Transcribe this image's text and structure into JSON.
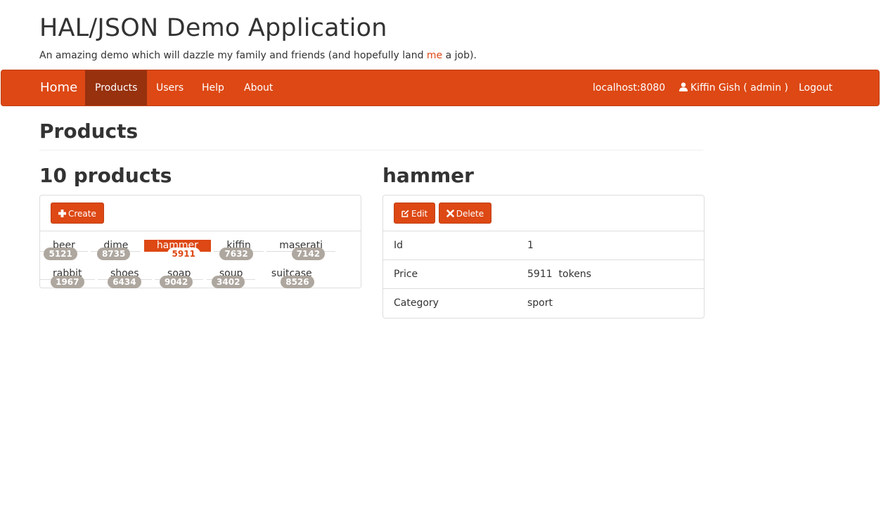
{
  "header": {
    "title": "HAL/JSON Demo Application",
    "tagline_before": "An amazing demo which will dazzle my family and friends (and hopefully land ",
    "tagline_link": "me",
    "tagline_after": " a job)."
  },
  "navbar": {
    "brand": "Home",
    "items": [
      {
        "label": "Products",
        "active": true
      },
      {
        "label": "Users"
      },
      {
        "label": "Help"
      },
      {
        "label": "About"
      }
    ],
    "host": "localhost:8080",
    "user": "Kiffin Gish ( admin )",
    "logout": "Logout"
  },
  "page": {
    "title": "Products"
  },
  "list": {
    "count_title": "10 products",
    "create_label": "Create",
    "items": [
      {
        "name": "beer",
        "value": "5121"
      },
      {
        "name": "dime",
        "value": "8735"
      },
      {
        "name": "hammer",
        "value": "5911",
        "active": true
      },
      {
        "name": "kiffin",
        "value": "7632"
      },
      {
        "name": "maserati",
        "value": "7142"
      },
      {
        "name": "rabbit",
        "value": "1967"
      },
      {
        "name": "shoes",
        "value": "6434"
      },
      {
        "name": "soap",
        "value": "9042"
      },
      {
        "name": "soup",
        "value": "3402"
      },
      {
        "name": "suitcase",
        "value": "8526"
      }
    ]
  },
  "detail": {
    "title": "hammer",
    "edit_label": "Edit",
    "delete_label": "Delete",
    "rows": [
      {
        "label": "Id",
        "value": "1"
      },
      {
        "label": "Price",
        "value": "5911  tokens"
      },
      {
        "label": "Category",
        "value": "sport"
      }
    ]
  },
  "colors": {
    "accent": "#dd4814",
    "nav_active": "#97310e",
    "badge": "#aea79f"
  },
  "icons": {
    "create": "plus-icon",
    "edit": "edit-icon",
    "delete": "times-icon",
    "user": "user-icon"
  }
}
